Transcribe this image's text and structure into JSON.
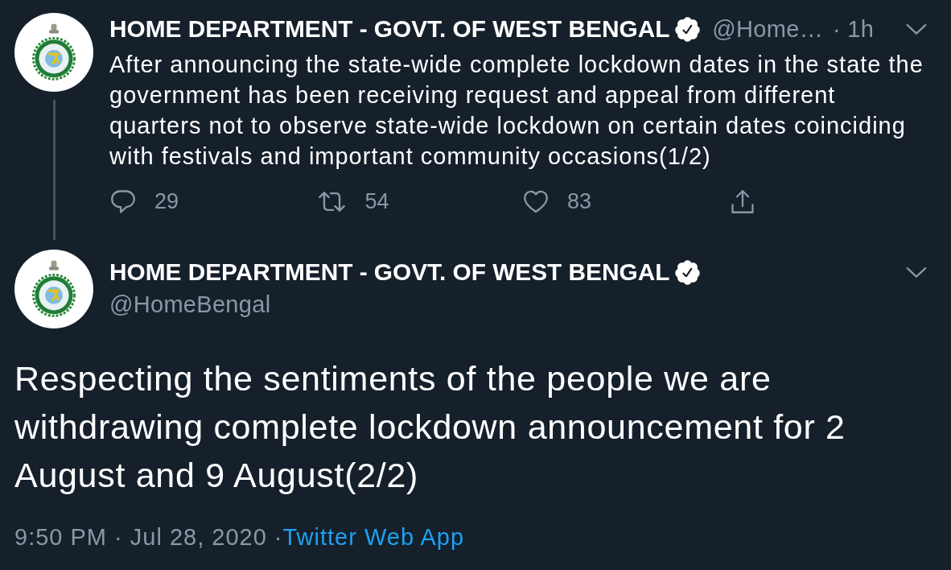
{
  "parent_tweet": {
    "author": {
      "name": "HOME DEPARTMENT - GOVT. OF WEST BENGAL",
      "verified": true,
      "handle": "@Home…"
    },
    "time": "· 1h",
    "text": "After announcing the state-wide complete lockdown dates in the state the government has been receiving request and appeal from different quarters not to observe state-wide lockdown on certain dates coinciding with festivals and important community occasions(1/2)",
    "actions": [
      {
        "kind": "reply",
        "count": "29"
      },
      {
        "kind": "retweet",
        "count": "54"
      },
      {
        "kind": "like",
        "count": "83"
      },
      {
        "kind": "share"
      }
    ]
  },
  "main_tweet": {
    "author": {
      "name": "HOME DEPARTMENT - GOVT. OF WEST BENGAL",
      "verified": true,
      "handle": "@HomeBengal"
    },
    "text": "Respecting the sentiments of the people we are withdrawing complete lockdown announcement for 2 August and 9 August(2/2)",
    "meta": "9:50 PM · Jul 28, 2020 ·",
    "source": "Twitter Web App"
  }
}
